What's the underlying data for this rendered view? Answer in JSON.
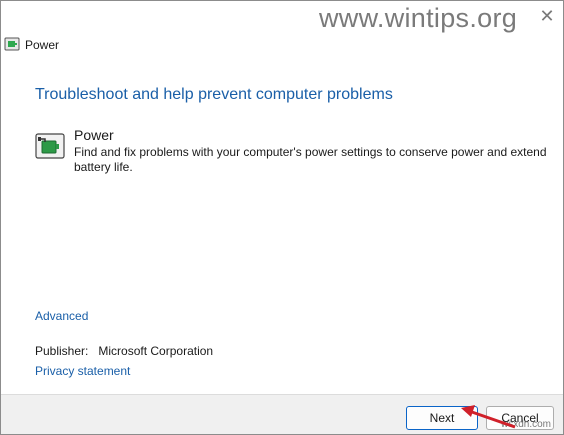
{
  "window": {
    "title": "Power"
  },
  "watermark": "www.wintips.org",
  "close_glyph": "✕",
  "main": {
    "heading": "Troubleshoot and help prevent computer problems",
    "item": {
      "title": "Power",
      "description": "Find and fix problems with your computer's power settings to conserve power and extend battery life.",
      "icon": "battery-plug-icon"
    },
    "advanced_link": "Advanced",
    "publisher_label": "Publisher:",
    "publisher_value": "Microsoft Corporation",
    "privacy_link": "Privacy statement"
  },
  "footer": {
    "next_label": "Next",
    "cancel_label": "Cancel",
    "watermark2": "wsxdn.com"
  },
  "colors": {
    "link": "#1a5fa8",
    "accent_border": "#0a64c8",
    "arrow": "#d0202a"
  }
}
